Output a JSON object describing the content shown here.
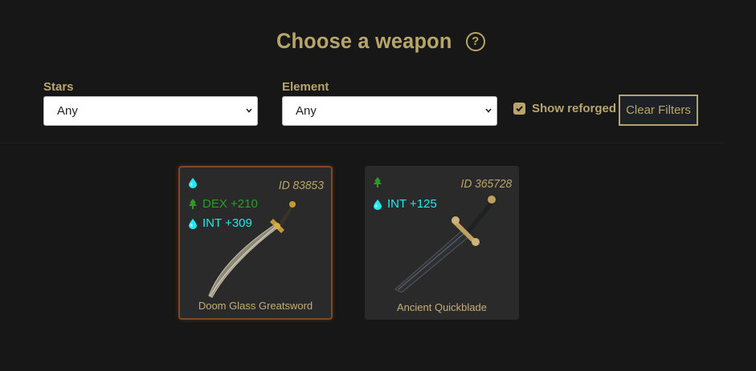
{
  "header": {
    "title": "Choose a weapon",
    "help_icon": "?"
  },
  "filters": {
    "stars": {
      "label": "Stars",
      "value": "Any"
    },
    "element": {
      "label": "Element",
      "value": "Any"
    },
    "show_reforged": {
      "label": "Show reforged",
      "checked": true
    },
    "clear_label": "Clear Filters"
  },
  "colors": {
    "accent": "#b8a56a",
    "dex": "#2e9a2a",
    "int": "#22e8f0",
    "background": "#171717",
    "card": "#2a2a2a"
  },
  "weapons": [
    {
      "id": "ID 83853",
      "name": "Doom Glass Greatsword",
      "element_icon": "water-drop-icon",
      "selected": true,
      "stats": [
        {
          "icon": "tree-icon",
          "text": "DEX +210"
        },
        {
          "icon": "water-drop-icon",
          "text": "INT +309"
        }
      ]
    },
    {
      "id": "ID 365728",
      "name": "Ancient Quickblade",
      "element_icon": "tree-icon",
      "selected": false,
      "stats": [
        {
          "icon": "water-drop-icon",
          "text": "INT +125"
        }
      ]
    }
  ]
}
